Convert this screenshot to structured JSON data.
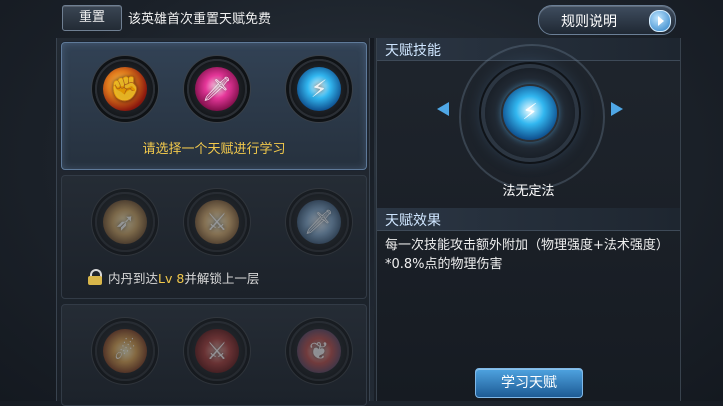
{
  "top_bar": {
    "reset_label": "重置",
    "reset_note": "该英雄首次重置天赋免费",
    "rules_label": "规则说明"
  },
  "talent_tiers": [
    {
      "hint": "请选择一个天赋进行学习",
      "skills": [
        {
          "icon": "flaming-fist-icon"
        },
        {
          "icon": "pink-sword-icon"
        },
        {
          "icon": "lightning-blade-icon"
        }
      ]
    },
    {
      "lock_prefix": "内丹到达",
      "lock_level": "Lv 8",
      "lock_suffix": "并解锁上一层",
      "skills": [
        {
          "icon": "golden-spear-icon"
        },
        {
          "icon": "golden-blade-icon"
        },
        {
          "icon": "steel-sword-icon"
        }
      ]
    },
    {
      "skills": [
        {
          "icon": "fire-horn-icon"
        },
        {
          "icon": "crimson-blade-icon"
        },
        {
          "icon": "red-wing-icon"
        }
      ]
    }
  ],
  "detail": {
    "skill_section_title": "天赋技能",
    "selected_skill_name": "法无定法",
    "effect_section_title": "天赋效果",
    "effect_text": "每一次技能攻击额外附加（物理强度+法术强度）*0.8%点的物理伤害"
  },
  "learn_button_label": "学习天赋",
  "colors": {
    "accent_blue": "#4fa3e0",
    "hint_gold": "#f2c94c",
    "header_text": "#cfe6ff"
  }
}
